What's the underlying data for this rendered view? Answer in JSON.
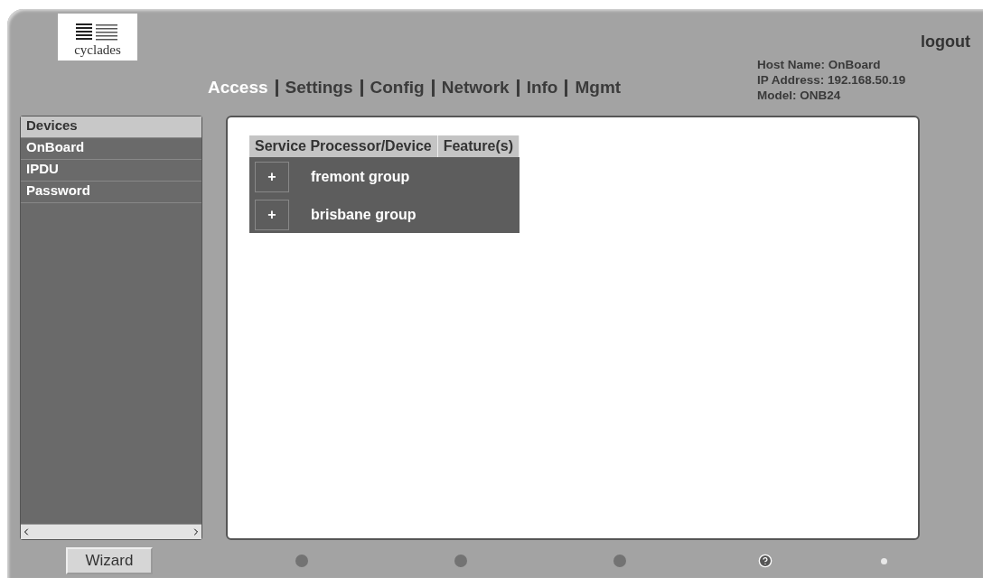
{
  "logo": {
    "text": "cyclades"
  },
  "nav": [
    {
      "label": "Access",
      "selected": true
    },
    {
      "label": "Settings",
      "selected": false
    },
    {
      "label": "Config",
      "selected": false
    },
    {
      "label": "Network",
      "selected": false
    },
    {
      "label": "Info",
      "selected": false
    },
    {
      "label": "Mgmt",
      "selected": false
    }
  ],
  "logout": "logout",
  "host_info": [
    "Host Name: OnBoard",
    "IP Address: 192.168.50.19",
    "Model: ONB24"
  ],
  "sidebar": {
    "items": [
      {
        "label": "Devices",
        "selected": true
      },
      {
        "label": "OnBoard",
        "selected": false
      },
      {
        "label": "IPDU",
        "selected": false
      },
      {
        "label": "Password",
        "selected": false
      }
    ]
  },
  "table": {
    "columns": [
      "Service Processor/Device",
      "Feature(s)"
    ],
    "rows": [
      {
        "expander": "+",
        "name": "fremont group"
      },
      {
        "expander": "+",
        "name": "brisbane group"
      }
    ]
  },
  "wizard_button": "Wizard"
}
